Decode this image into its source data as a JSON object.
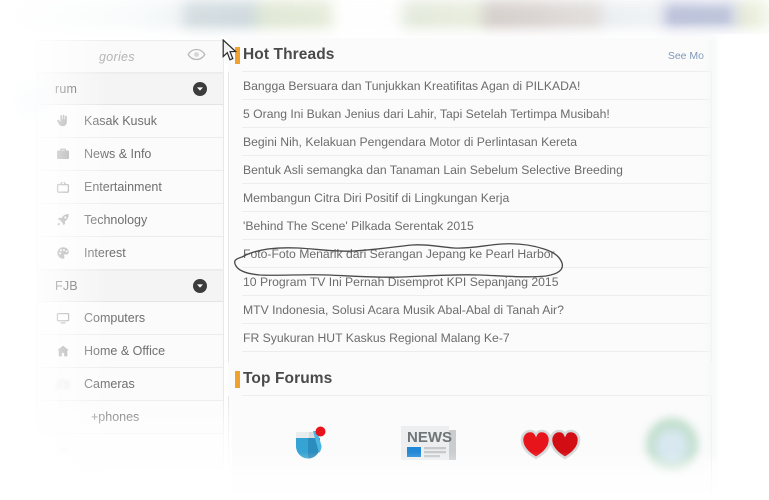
{
  "banner": {
    "name": "blurred-site-header"
  },
  "sidebar": {
    "categories_label": "gories",
    "eye_icon": "eye-icon",
    "sections": [
      {
        "header": "rum",
        "chevron": "chevron-down-icon",
        "items": [
          {
            "label": "Kasak Kusuk",
            "icon": "hand-icon"
          },
          {
            "label": "News & Info",
            "icon": "briefcase-icon"
          },
          {
            "label": "Entertainment",
            "icon": "tv-icon"
          },
          {
            "label": "Technology",
            "icon": "rocket-icon"
          },
          {
            "label": "Interest",
            "icon": "palette-icon"
          }
        ]
      },
      {
        "header": "FJB",
        "chevron": "chevron-down-icon",
        "items": [
          {
            "label": "Computers",
            "icon": "monitor-icon"
          },
          {
            "label": "Home & Office",
            "icon": "house-icon"
          },
          {
            "label": "Cameras",
            "icon": "camera-icon"
          },
          {
            "label": "+phones",
            "icon": "headphones-icon"
          }
        ]
      }
    ]
  },
  "main": {
    "hot_threads": {
      "title": "Hot Threads",
      "see_more_label": "See Mo",
      "accent_color": "#f0a22e",
      "threads": [
        "Bangga Bersuara dan Tunjukkan Kreatifitas Agan di PILKADA!",
        "5 Orang Ini Bukan Jenius dari Lahir, Tapi Setelah Tertimpa Musibah!",
        "Begini Nih, Kelakuan Pengendara Motor di Perlintasan Kereta",
        "Bentuk Asli semangka dan Tanaman Lain Sebelum Selective Breeding",
        "Membangun Citra Diri Positif di Lingkungan Kerja",
        "'Behind The Scene' Pilkada Serentak 2015",
        "Foto-Foto Menarik dari Serangan Jepang ke Pearl Harbor",
        "10 Program TV Ini Pernah Disemprot KPI Sepanjang 2015",
        "MTV Indonesia, Solusi Acara Musik Abal-Abal di Tanah Air?",
        "FR Syukuran HUT Kaskus Regional Malang Ke-7"
      ],
      "highlighted_thread_index": 6
    },
    "top_forums": {
      "title": "Top Forums",
      "accent_color": "#f0a22e",
      "tiles": [
        {
          "icon": "mortar-pestle-icon",
          "color": "#35a3d4"
        },
        {
          "icon": "news-paper-icon",
          "color": "#2389d6"
        },
        {
          "icon": "double-heart-icon",
          "color": "#e8141b"
        },
        {
          "icon": "globe-icon",
          "color": "#8fc6a6"
        }
      ]
    }
  },
  "annotation": {
    "type": "hand-drawn-circle",
    "color": "#4a4a4a",
    "target": "Foto-Foto Menarik dari Serangan Jepang ke Pearl Harbor"
  },
  "cursor": {
    "type": "arrow-pointer"
  }
}
